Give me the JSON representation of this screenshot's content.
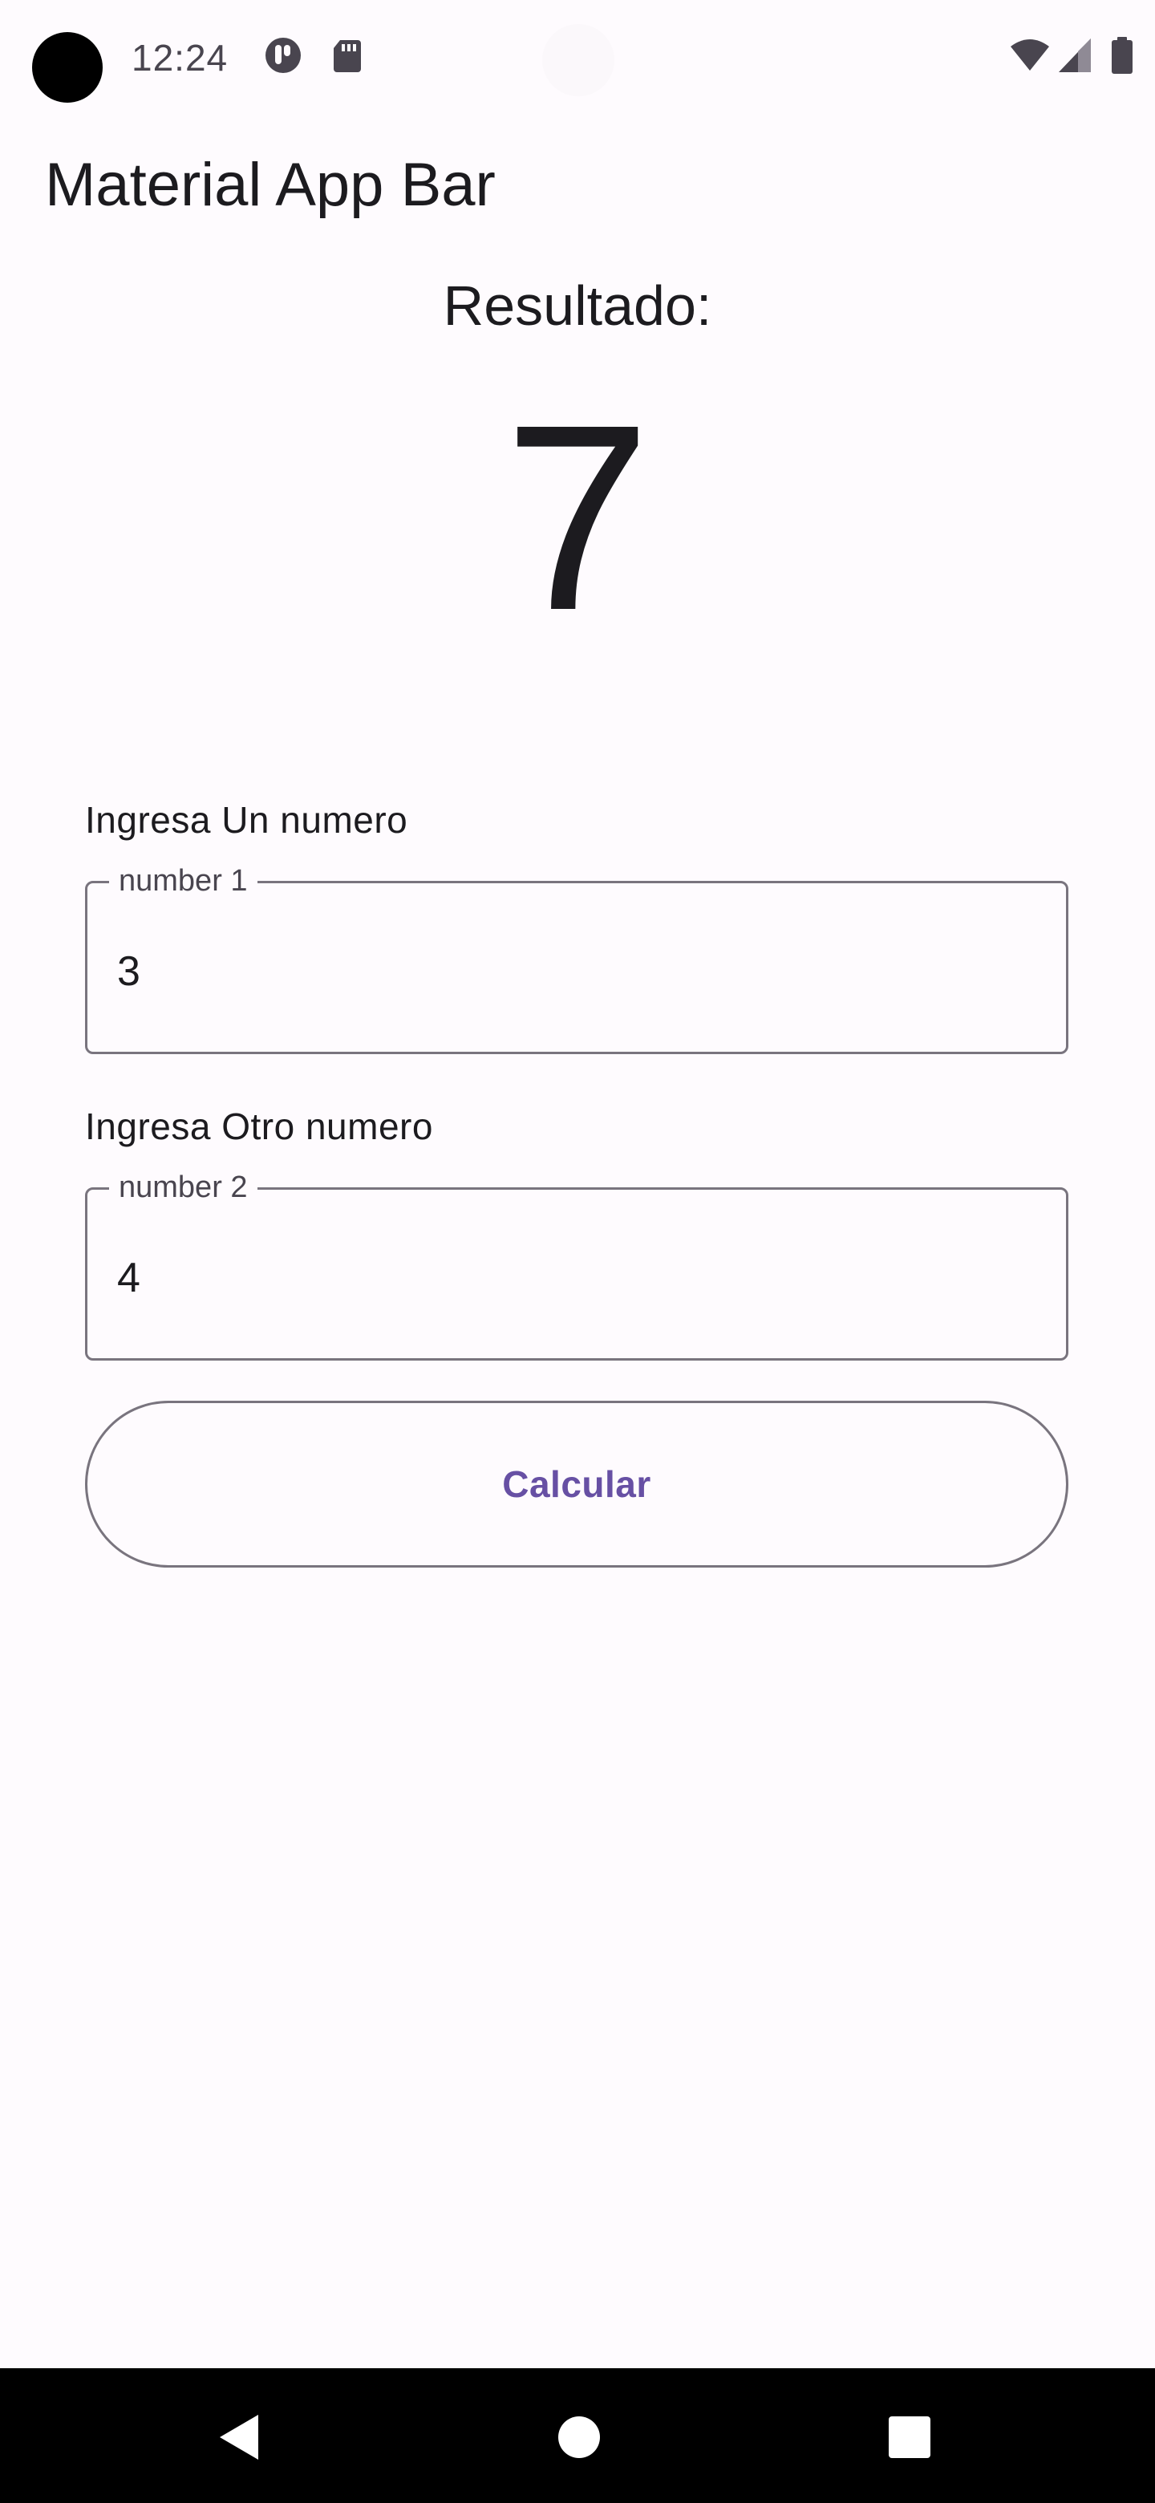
{
  "status_bar": {
    "time": "12:24",
    "icons": [
      "camera-dot",
      "app-notification-icon",
      "sd-card-icon",
      "wifi-icon",
      "cell-signal-icon",
      "battery-icon"
    ]
  },
  "app_bar": {
    "title": "Material App Bar"
  },
  "result": {
    "label": "Resultado:",
    "value": "7"
  },
  "form": {
    "field1": {
      "caption": "Ingresa Un numero",
      "floating_label": "number 1",
      "value": "3"
    },
    "field2": {
      "caption": "Ingresa Otro numero",
      "floating_label": "number 2",
      "value": "4"
    },
    "button_label": "Calcular"
  },
  "navigation": {
    "icons": [
      "back-icon",
      "home-icon",
      "recents-icon"
    ]
  },
  "colors": {
    "background": "#fefbfe",
    "text": "#1c1b1f",
    "outline": "#79747e",
    "primary": "#6750a4",
    "nav_bar": "#000000"
  }
}
